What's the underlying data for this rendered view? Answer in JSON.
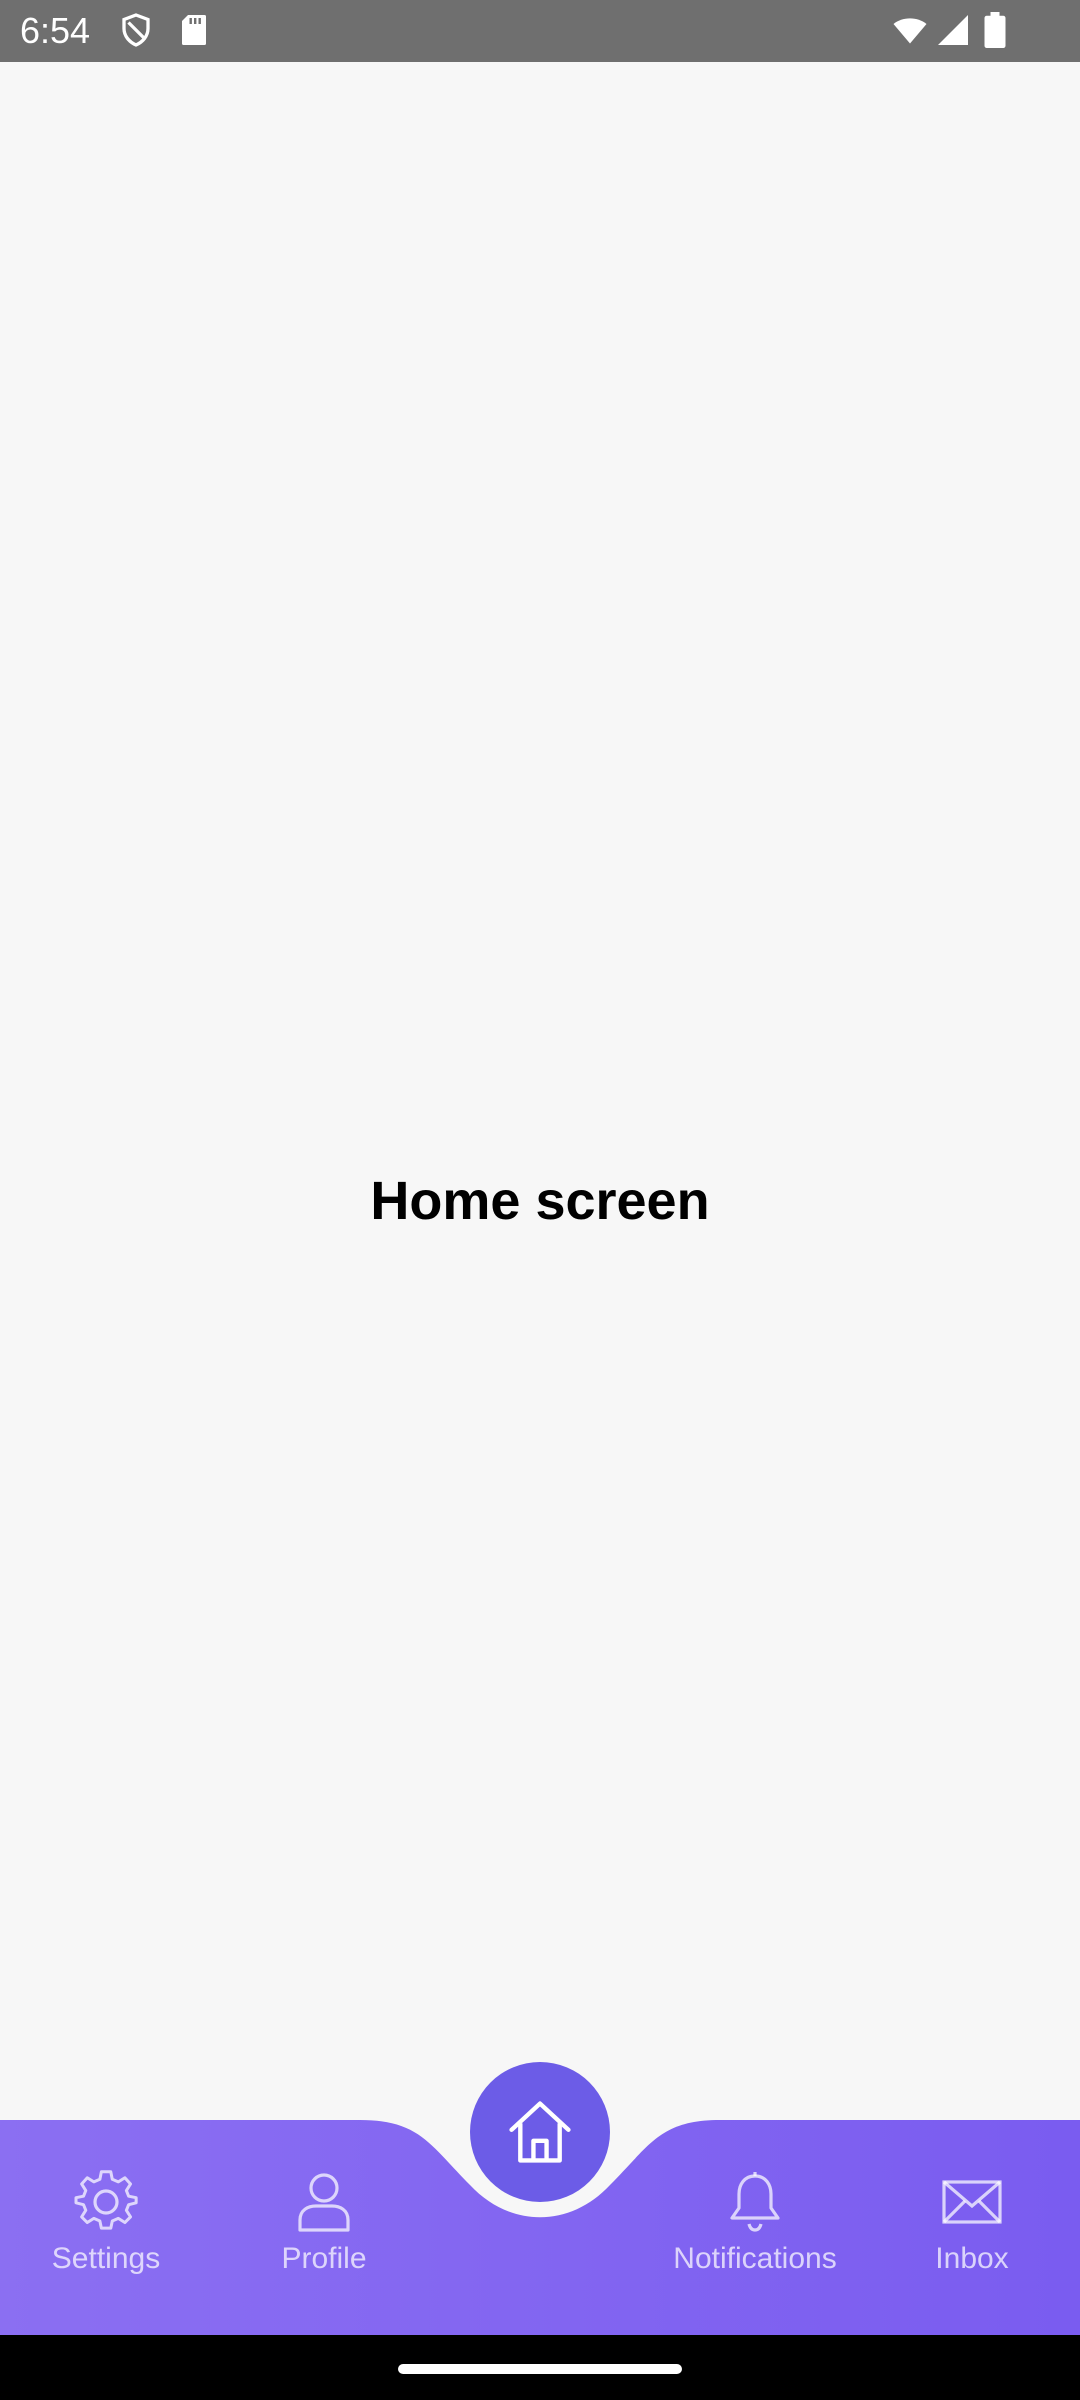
{
  "status_bar": {
    "time": "6:54",
    "left_icons": [
      "shield-icon",
      "sd-card-icon"
    ],
    "right_icons": [
      "wifi-icon",
      "cellular-signal-icon",
      "battery-icon"
    ]
  },
  "main": {
    "title": "Home screen"
  },
  "bottom_nav": {
    "items": [
      {
        "label": "Settings",
        "icon": "gear-icon"
      },
      {
        "label": "Profile",
        "icon": "user-icon"
      },
      {
        "label": "Notifications",
        "icon": "bell-icon"
      },
      {
        "label": "Inbox",
        "icon": "mail-icon"
      }
    ],
    "center": {
      "icon": "home-icon",
      "active": true
    }
  },
  "colors": {
    "nav_start": "#8a6cf0",
    "nav_end": "#7b5cf2",
    "fab": "#6c5ce7",
    "status_bar": "#6f6f6f",
    "background": "#f7f7f7"
  }
}
